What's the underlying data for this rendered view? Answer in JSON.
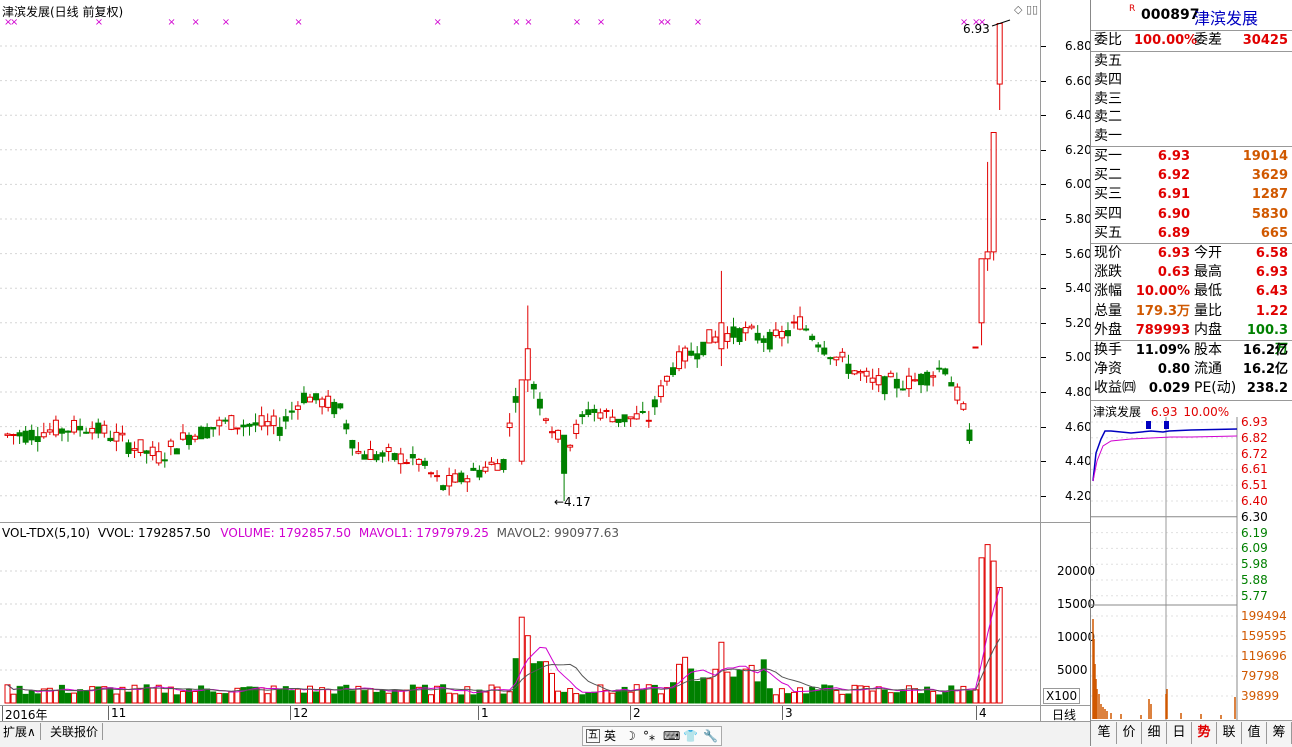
{
  "main_chart": {
    "title": "津滨发展(日线 前复权)",
    "y_ticks": [
      "6.80",
      "6.60",
      "6.40",
      "6.20",
      "6.00",
      "5.80",
      "5.60",
      "5.40",
      "5.20",
      "5.00",
      "4.80",
      "4.60",
      "4.40",
      "4.20"
    ],
    "high_label": "6.93",
    "low_label": "←4.17",
    "mark_symbol": "×"
  },
  "volume": {
    "indicator": "VOL-TDX(5,10)",
    "vvol": "VVOL: 1792857.50",
    "volume": "VOLUME: 1792857.50",
    "mavol1": "MAVOL1: 1797979.25",
    "mavol2": "MAVOL2: 990977.63",
    "y_ticks": [
      "20000",
      "15000",
      "10000",
      "5000"
    ],
    "unit": "X100"
  },
  "x_axis": {
    "labels": [
      "2016年",
      "11",
      "12",
      "1",
      "2",
      "3",
      "4"
    ],
    "period": "日线"
  },
  "bottom_tabs": [
    "扩展∧",
    "关联报价"
  ],
  "toolbar_icons": [
    "五",
    "英",
    "moon-icon",
    "dots-icon",
    "keyboard-icon",
    "shirt-icon",
    "wrench-icon"
  ],
  "quote": {
    "code_badge": "R",
    "code": "000897",
    "name": "津滨发展",
    "weibi_label": "委比",
    "weibi": "100.00%",
    "weicha_label": "委差",
    "weicha": "30425",
    "sell": [
      {
        "label": "卖五"
      },
      {
        "label": "卖四"
      },
      {
        "label": "卖三"
      },
      {
        "label": "卖二"
      },
      {
        "label": "卖一"
      }
    ],
    "buy": [
      {
        "label": "买一",
        "price": "6.93",
        "vol": "19014"
      },
      {
        "label": "买二",
        "price": "6.92",
        "vol": "3629"
      },
      {
        "label": "买三",
        "price": "6.91",
        "vol": "1287"
      },
      {
        "label": "买四",
        "price": "6.90",
        "vol": "5830"
      },
      {
        "label": "买五",
        "price": "6.89",
        "vol": "665"
      }
    ],
    "stats": [
      {
        "l1": "现价",
        "v1": "6.93",
        "l2": "今开",
        "v2": "6.58"
      },
      {
        "l1": "涨跌",
        "v1": "0.63",
        "l2": "最高",
        "v2": "6.93"
      },
      {
        "l1": "涨幅",
        "v1": "10.00%",
        "l2": "最低",
        "v2": "6.43"
      },
      {
        "l1": "总量",
        "v1": "179.3万",
        "l2": "量比",
        "v2": "1.22"
      },
      {
        "l1": "外盘",
        "v1": "789993",
        "l2": "内盘",
        "v2": "100.3万"
      }
    ],
    "fund": [
      {
        "l1": "换手",
        "v1": "11.09%",
        "l2": "股本",
        "v2": "16.2亿"
      },
      {
        "l1": "净资",
        "v1": "0.80",
        "l2": "流通",
        "v2": "16.2亿"
      },
      {
        "l1": "收益㈣",
        "v1": "0.029",
        "l2": "PE(动)",
        "v2": "238.2"
      }
    ]
  },
  "mini": {
    "name": "津滨发展",
    "price": "6.93",
    "pct": "10.00%",
    "price_ticks": [
      "6.93",
      "6.82",
      "6.72",
      "6.61",
      "6.51",
      "6.40",
      "6.30",
      "6.19",
      "6.09",
      "5.98",
      "5.88",
      "5.77"
    ],
    "vol_ticks": [
      "199494",
      "159595",
      "119696",
      "79798",
      "39899"
    ]
  },
  "right_tabs": [
    "笔",
    "价",
    "细",
    "日",
    "势",
    "联",
    "值",
    "筹"
  ],
  "chart_data": {
    "type": "candlestick",
    "note_series": [
      "MAVOL1",
      "MAVOL2"
    ],
    "candles_last": [
      {
        "o": 4.58,
        "h": 4.62,
        "l": 4.5,
        "c": 4.52
      },
      {
        "o": 5.06,
        "h": 5.06,
        "l": 5.06,
        "c": 5.06
      },
      {
        "o": 5.2,
        "h": 5.57,
        "l": 5.07,
        "c": 5.57
      },
      {
        "o": 5.57,
        "h": 6.13,
        "l": 5.5,
        "c": 5.61
      },
      {
        "o": 5.61,
        "h": 6.3,
        "l": 5.56,
        "c": 6.3
      },
      {
        "o": 6.58,
        "h": 6.93,
        "l": 6.43,
        "c": 6.93
      }
    ]
  }
}
